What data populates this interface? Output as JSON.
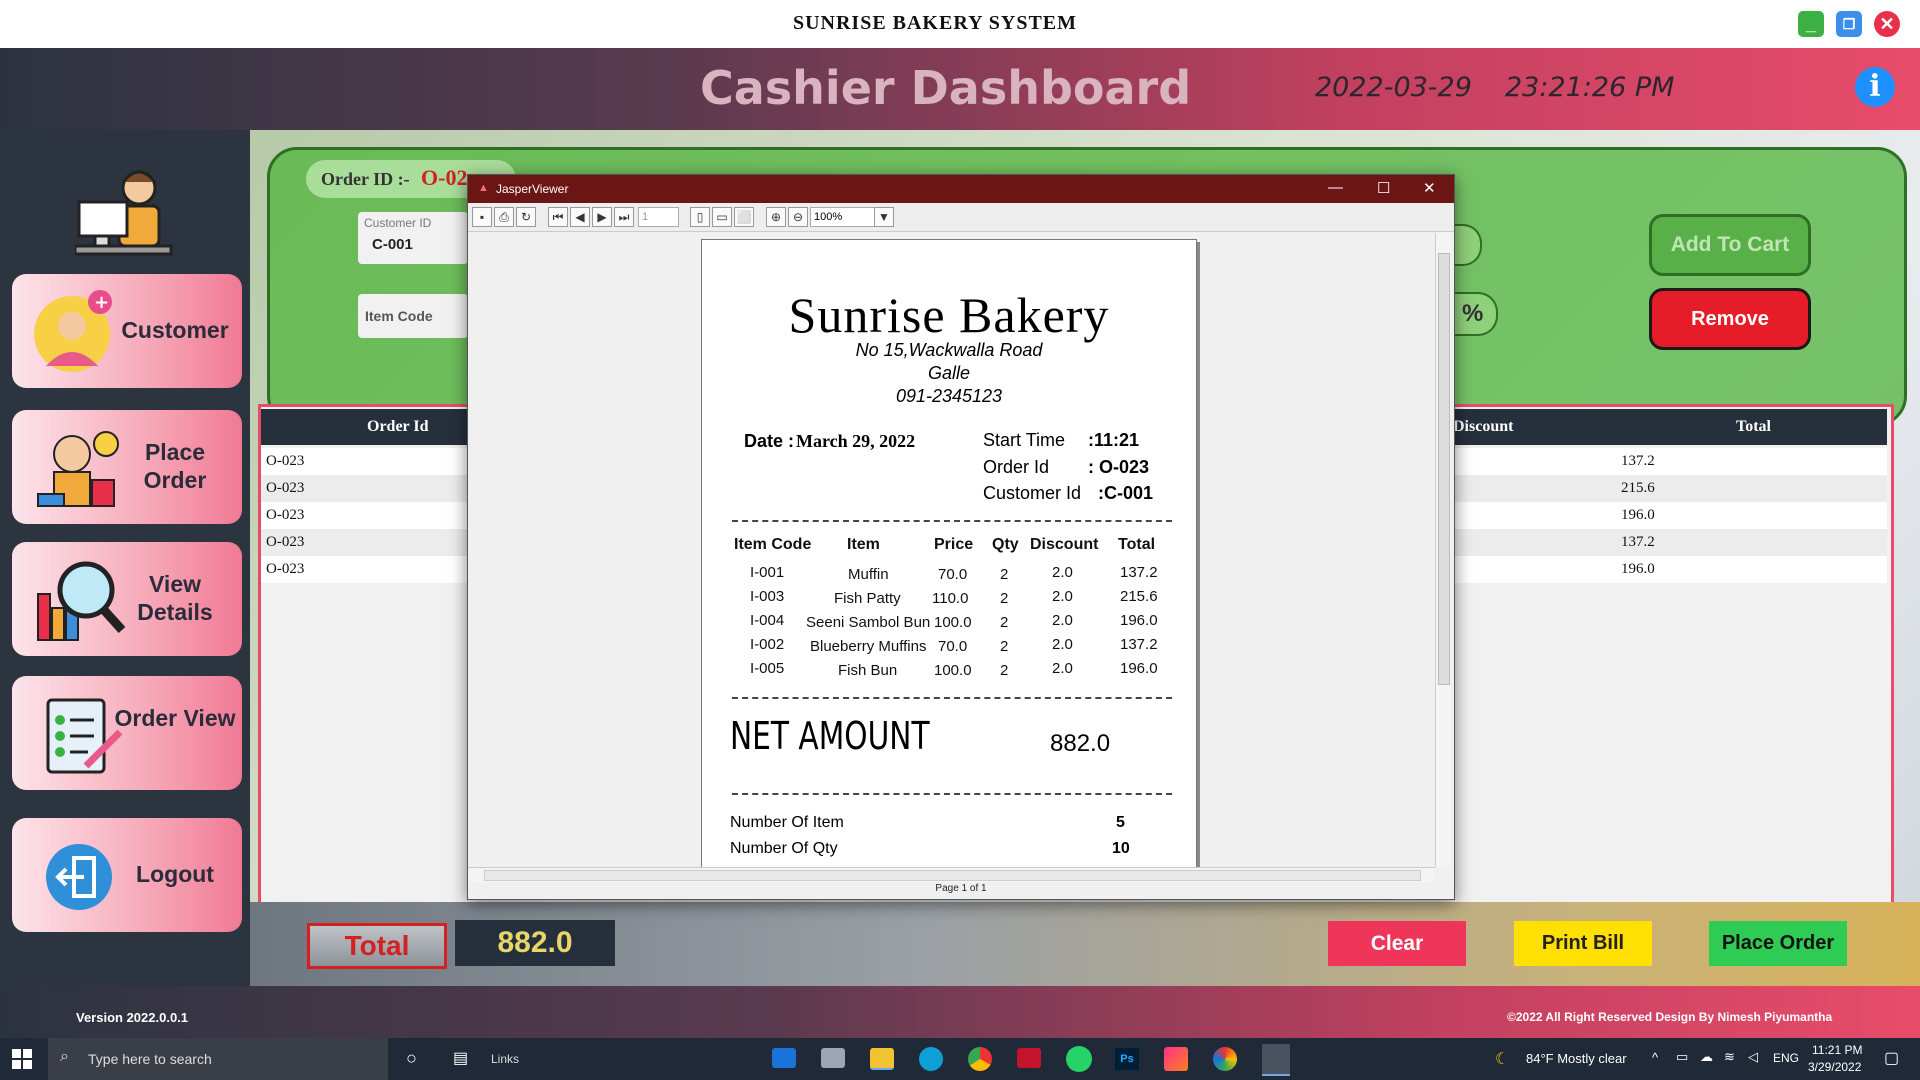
{
  "window": {
    "title": "SUNRISE BAKERY SYSTEM"
  },
  "header": {
    "title": "Cashier Dashboard",
    "date": "2022-03-29",
    "time": "23:21:26 PM",
    "info_icon": "i"
  },
  "sidebar": {
    "items": [
      {
        "label": "Customer"
      },
      {
        "label": "Place Order"
      },
      {
        "label": "View Details"
      },
      {
        "label": "Order View"
      },
      {
        "label": "Logout"
      }
    ]
  },
  "order_form": {
    "order_id_label": "Order ID  :-",
    "order_id_value": "O-02",
    "customer_id_placeholder": "Customer ID",
    "customer_id_value": "C-001",
    "item_code_placeholder": "Item Code",
    "percent_symbol": "%",
    "add_to_cart": "Add To Cart",
    "remove": "Remove"
  },
  "table": {
    "columns": [
      "Order Id",
      "Discount",
      "Total"
    ],
    "rows": [
      {
        "order_id": "O-023",
        "total": "137.2"
      },
      {
        "order_id": "O-023",
        "total": "215.6"
      },
      {
        "order_id": "O-023",
        "total": "196.0"
      },
      {
        "order_id": "O-023",
        "total": "137.2"
      },
      {
        "order_id": "O-023",
        "total": "196.0"
      }
    ]
  },
  "bottom": {
    "total_label": "Total",
    "total_value": "882.0",
    "clear": "Clear",
    "print_bill": "Print Bill",
    "place_order": "Place Order"
  },
  "footer": {
    "version": "Version 2022.0.0.1",
    "copyright": "©2022  All Right Reserved Design By Nimesh Piyumantha"
  },
  "jasper": {
    "title": "JasperViewer",
    "page_field": "1",
    "zoom": "100%",
    "page_status": "Page 1 of 1",
    "receipt": {
      "shop": "Sunrise Bakery",
      "address1": "No 15,Wackwalla Road",
      "address2": "Galle",
      "phone": "091-2345123",
      "date_label": "Date :",
      "date_value": "March 29, 2022",
      "start_time_label": "Start Time",
      "start_time_value": ":11:21",
      "order_id_label": "Order Id",
      "order_id_value": ": O-023",
      "customer_id_label": "Customer Id",
      "customer_id_value": ":C-001",
      "item_headers": [
        "Item Code",
        "Item",
        "Price",
        "Qty",
        "Discount",
        "Total"
      ],
      "items": [
        [
          "I-001",
          "Muffin",
          "70.0",
          "2",
          "2.0",
          "137.2"
        ],
        [
          "I-003",
          "Fish Patty",
          "110.0",
          "2",
          "2.0",
          "215.6"
        ],
        [
          "I-004",
          "Seeni Sambol Bun",
          "100.0",
          "2",
          "2.0",
          "196.0"
        ],
        [
          "I-002",
          "Blueberry Muffins",
          "70.0",
          "2",
          "2.0",
          "137.2"
        ],
        [
          "I-005",
          "Fish Bun",
          "100.0",
          "2",
          "2.0",
          "196.0"
        ]
      ],
      "net_amount_label": "NET AMOUNT",
      "net_amount_value": "882.0",
      "num_items_label": "Number Of Item",
      "num_items_value": "5",
      "num_qty_label": "Number Of Qty",
      "num_qty_value": "10"
    }
  },
  "taskbar": {
    "search_placeholder": "Type here to search",
    "links": "Links",
    "weather": "84°F  Mostly clear",
    "lang": "ENG",
    "clock_time": "11:21 PM",
    "clock_date": "3/29/2022"
  }
}
